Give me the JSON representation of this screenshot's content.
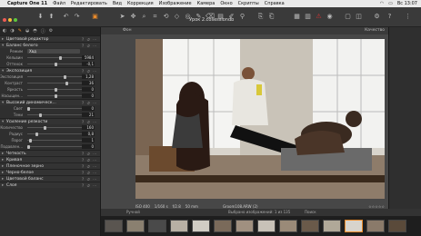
{
  "menubar": {
    "apple": "",
    "items": [
      "Capture One 11",
      "Файл",
      "Редактировать",
      "Вид",
      "Коррекция",
      "Изображение",
      "Камера",
      "Окно",
      "Скрипты",
      "Справка"
    ],
    "right": [
      "Вс 13:07"
    ]
  },
  "window": {
    "title": "Урок 2.cosessiondb"
  },
  "toolbar": {
    "icons": [
      "import-icon",
      "export-icon",
      "pointer-icon",
      "crop-icon",
      "rotate-icon",
      "keystone-icon",
      "spot-icon",
      "brush-icon",
      "eraser-icon",
      "gradient-icon",
      "picker-icon",
      "wb-picker-icon",
      "copy-icon",
      "paste-icon",
      "undo-icon",
      "redo-icon",
      "grid-icon",
      "warning-icon",
      "focus-icon",
      "proof-icon",
      "compare-icon",
      "settings-icon",
      "help-icon"
    ]
  },
  "panel": {
    "tabs": [
      "◐",
      "◑",
      "✎",
      "◒",
      "◓",
      "ⓘ",
      "⚙"
    ],
    "color_editor": "Цветовой редактор",
    "white_balance": {
      "title": "Баланс белого",
      "mode_label": "Режим",
      "mode_value": "Хвд",
      "temp_label": "Кельвин",
      "temp_value": "5984",
      "tint_label": "Оттенок",
      "tint_value": "-0,1"
    },
    "exposure": {
      "title": "Экспозиция",
      "exp_label": "Экспозиция",
      "exp_value": "1,28",
      "contrast_label": "Контраст",
      "contrast_value": "36",
      "brightness_label": "Яркость",
      "brightness_value": "0",
      "saturation_label": "Насыщен...",
      "saturation_value": "0"
    },
    "hdr": {
      "title": "Высокий динамическ...",
      "light_label": "Свет",
      "light_value": "0",
      "shadow_label": "Тени",
      "shadow_value": "21"
    },
    "sharpening": {
      "title": "Усиление резкости",
      "amount_label": "Количество",
      "amount_value": "160",
      "radius_label": "Радиус",
      "radius_value": "0,8",
      "threshold_label": "Порог",
      "threshold_value": "1",
      "halo_label": "Подавлен...",
      "halo_value": "0"
    },
    "collapsed": [
      "Четкость",
      "Кривая",
      "Пленочное зерно",
      "Черно-белое",
      "Цветовой баланс",
      "Слоя"
    ]
  },
  "viewer": {
    "mode": "Фон",
    "right_label": "Качество",
    "iso": "ISO 400",
    "shutter": "1/160 s",
    "aperture": "f/2.8",
    "focal": "50 mm",
    "filename": "Groom108.ARW (2)"
  },
  "filmbar": {
    "sort": "Ручной",
    "count": "Выбрано изображений: 1 из 135",
    "search_placeholder": "Поиск"
  },
  "colors": {
    "accent": "#e88a2a",
    "panel_bg": "#2f2f2f",
    "viewer_bg": "#474747"
  }
}
